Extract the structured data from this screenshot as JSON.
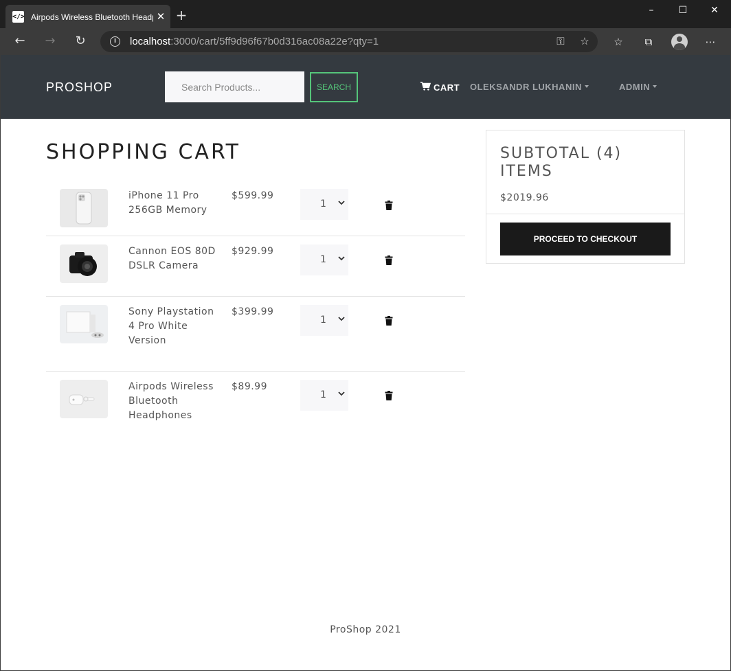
{
  "browser": {
    "tab_title": "Airpods Wireless Bluetooth Headphones",
    "tab_favicon": "</>",
    "url_host": "localhost",
    "url_path": ":3000/cart/5ff9d96f67b0d316ac08a22e?qty=1",
    "icons": {
      "minimize": "minimize-icon",
      "maximize": "maximize-icon",
      "close": "close-icon",
      "back": "back-arrow-icon",
      "forward": "forward-arrow-icon",
      "refresh": "refresh-icon",
      "info": "info-icon",
      "key": "key-icon",
      "favorite": "star-icon",
      "favorites_list": "favorites-list-icon",
      "collections": "collections-icon",
      "profile": "profile-avatar-icon",
      "more": "more-icon"
    }
  },
  "navbar": {
    "brand": "PROSHOP",
    "search_placeholder": "Search Products...",
    "search_button": "SEARCH",
    "cart_label": "CART",
    "user_label": "OLEKSANDR LUKHANIN",
    "admin_label": "ADMIN",
    "accent_color": "#55c57a",
    "background_color": "#343a40"
  },
  "cart": {
    "title": "SHOPPING CART",
    "items": [
      {
        "name": "iPhone 11 Pro 256GB Memory",
        "price": "$599.99",
        "qty": "1"
      },
      {
        "name": "Cannon EOS 80D DSLR Camera",
        "price": "$929.99",
        "qty": "1"
      },
      {
        "name": "Sony Playstation 4 Pro White Version",
        "price": "$399.99",
        "qty": "1"
      },
      {
        "name": "Airpods Wireless Bluetooth Headphones",
        "price": "$89.99",
        "qty": "1"
      }
    ]
  },
  "summary": {
    "title": "SUBTOTAL (4) ITEMS",
    "total": "$2019.96",
    "checkout_button": "PROCEED TO CHECKOUT"
  },
  "footer": {
    "text": "ProShop 2021"
  }
}
